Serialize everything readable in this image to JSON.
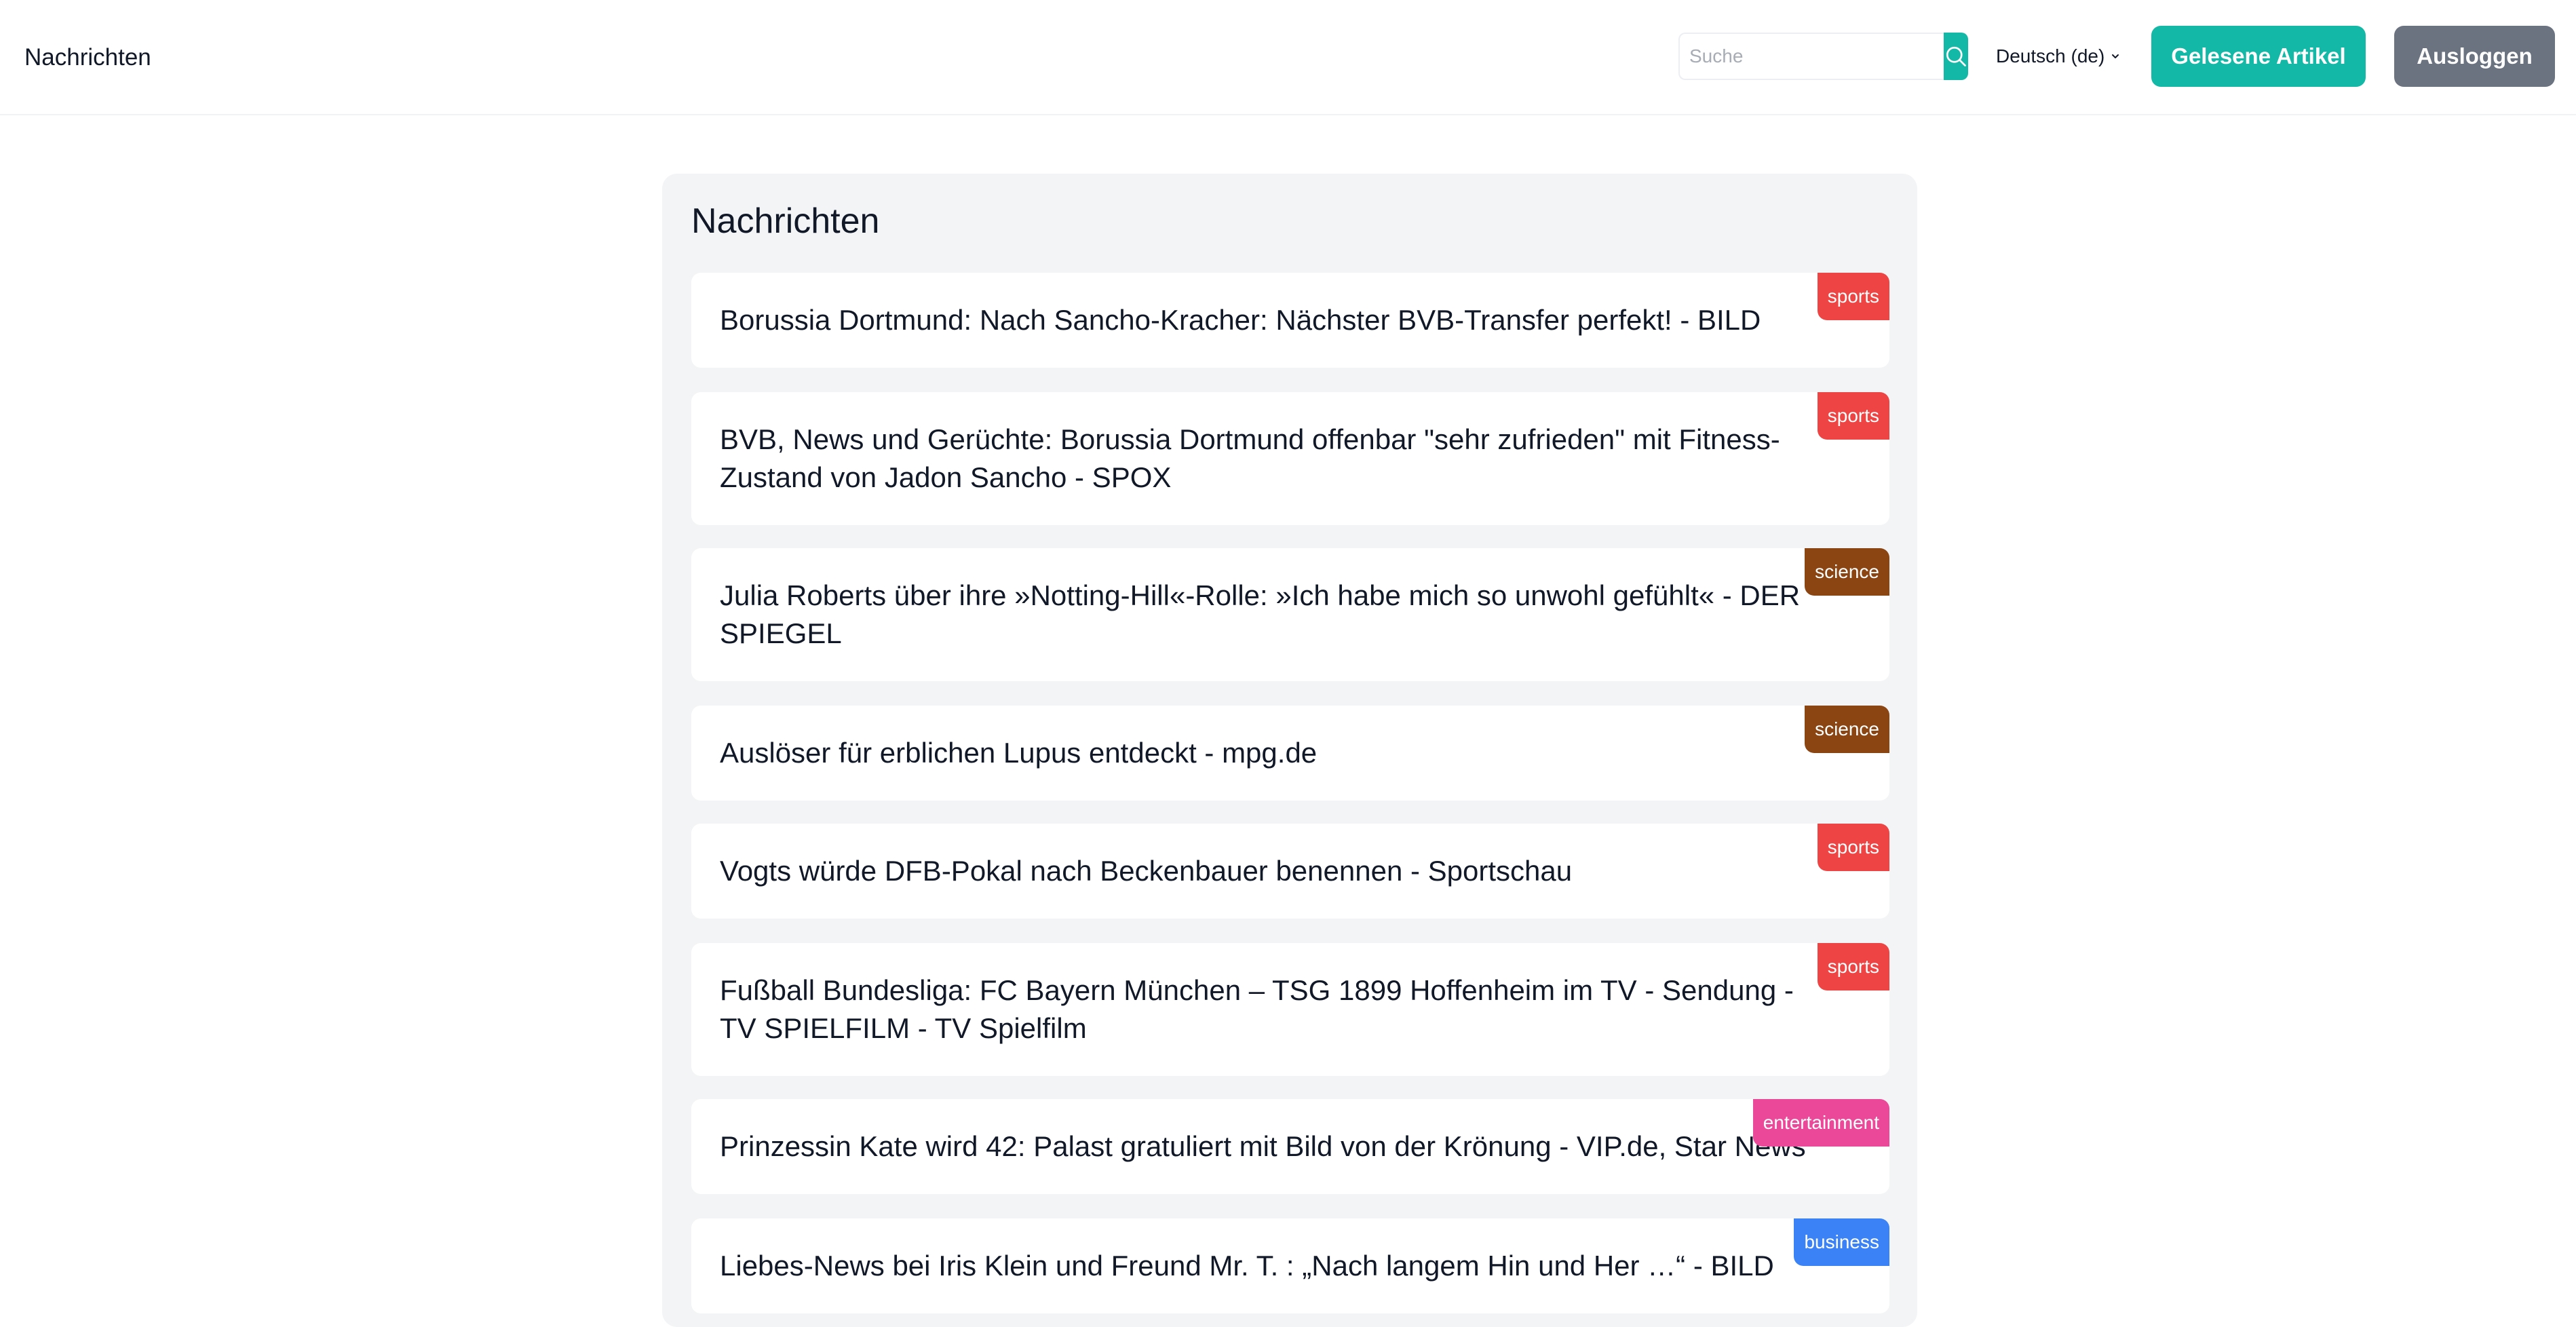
{
  "header": {
    "brand": "Nachrichten",
    "search_placeholder": "Suche",
    "language": "Deutsch (de)",
    "read_articles_label": "Gelesene Artikel",
    "logout_label": "Ausloggen"
  },
  "main": {
    "title": "Nachrichten",
    "articles": [
      {
        "title": "Borussia Dortmund: Nach Sancho-Kracher: Nächster BVB-Transfer perfekt! - BILD",
        "category": "sports"
      },
      {
        "title": "BVB, News und Gerüchte: Borussia Dortmund offenbar \"sehr zufrieden\" mit Fitness-Zustand von Jadon Sancho - SPOX",
        "category": "sports"
      },
      {
        "title": "Julia Roberts über ihre »Notting-Hill«-Rolle: »Ich habe mich so unwohl gefühlt« - DER SPIEGEL",
        "category": "science"
      },
      {
        "title": "Auslöser für erblichen Lupus entdeckt - mpg.de",
        "category": "science"
      },
      {
        "title": "Vogts würde DFB-Pokal nach Beckenbauer benennen - Sportschau",
        "category": "sports"
      },
      {
        "title": "Fußball Bundesliga: FC Bayern München – TSG 1899 Hoffenheim im TV - Sendung - TV SPIELFILM - TV Spielfilm",
        "category": "sports"
      },
      {
        "title": "Prinzessin Kate wird 42: Palast gratuliert mit Bild von der Krönung - VIP.de, Star News",
        "category": "entertainment"
      },
      {
        "title": "Liebes-News bei Iris Klein und Freund Mr. T. : „Nach langem Hin und Her …“ - BILD",
        "category": "business"
      }
    ]
  },
  "colors": {
    "accent": "#14b8a6",
    "logout": "#6b7280",
    "sports": "#ef4444",
    "science": "#8b4513",
    "entertainment": "#ec4899",
    "business": "#3b82f6"
  }
}
